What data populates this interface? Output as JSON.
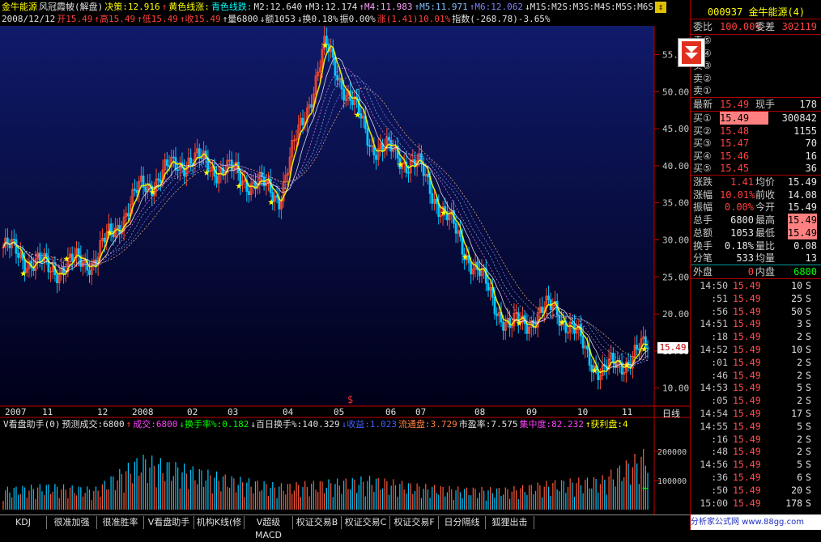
{
  "header": {
    "line1": [
      {
        "text": "金牛能源",
        "color": "#ffff00"
      },
      {
        "text": "风冠霞帔(解盘)",
        "color": "#e0e0e0"
      },
      {
        "text": "决策:12.916",
        "color": "#ffff00"
      },
      {
        "text": "↑",
        "color": "#ff4040"
      },
      {
        "text": "黄色线涨:",
        "color": "#ffff00"
      },
      {
        "text": "青色线跌:",
        "color": "#00ffff"
      },
      {
        "text": "M2:12.640",
        "color": "#e0e0e0"
      },
      {
        "text": "↑M3:12.174",
        "color": "#e0e0e0"
      },
      {
        "text": "↑M4:11.983",
        "color": "#ffa0ff"
      },
      {
        "text": "↑M5:11.971",
        "color": "#80c0ff"
      },
      {
        "text": "↑M6:12.062",
        "color": "#8080ff"
      },
      {
        "text": "↓M1S:M2S:M3S:M4S:M5S:M6S:",
        "color": "#e0e0e0"
      }
    ],
    "line2": [
      {
        "text": "2008/12/12",
        "color": "#e0e0e0"
      },
      {
        "text": "开15.49",
        "color": "#ff4040"
      },
      {
        "text": "↑高15.49",
        "color": "#ff4040"
      },
      {
        "text": "↑低15.49",
        "color": "#ff4040"
      },
      {
        "text": "↑收15.49",
        "color": "#ff4040"
      },
      {
        "text": "↑量6800",
        "color": "#e0e0e0"
      },
      {
        "text": "↓额1053",
        "color": "#e0e0e0"
      },
      {
        "text": "↓换0.18%",
        "color": "#e0e0e0"
      },
      {
        "text": "振0.00%",
        "color": "#e0e0e0"
      },
      {
        "text": "涨(1.41)10.01%",
        "color": "#ff4040"
      },
      {
        "text": "指数(-268.78)-3.65%",
        "color": "#e0e0e0"
      }
    ]
  },
  "indicator_header": [
    {
      "text": "V看盘助手(0)",
      "color": "#e0e0e0"
    },
    {
      "text": "预测成交:6800",
      "color": "#e0e0e0"
    },
    {
      "text": "↑",
      "color": "#ff4040"
    },
    {
      "text": "成交:6800",
      "color": "#ff40ff"
    },
    {
      "text": "↓换手率%:0.182",
      "color": "#00ff00"
    },
    {
      "text": "↓百日换手%:140.329",
      "color": "#e0e0e0"
    },
    {
      "text": "↓收益:1.023",
      "color": "#4060ff"
    },
    {
      "text": "流通盘:3.729",
      "color": "#ff8040"
    },
    {
      "text": "市盈率:7.575",
      "color": "#e0e0e0"
    },
    {
      "text": "集中度:82.232",
      "color": "#ff40ff"
    },
    {
      "text": "↑获利盘:4",
      "color": "#ffff00"
    }
  ],
  "day_line_label": "日线",
  "current_price_tag": "15.49",
  "y_axis_ticks": [
    "55.00",
    "50.00",
    "45.00",
    "40.00",
    "35.00",
    "30.00",
    "25.00",
    "20.00",
    "15.00",
    "10.00"
  ],
  "volume_axis_ticks": [
    "200000",
    "100000"
  ],
  "x_axis_labels": [
    "2007",
    "11",
    "12",
    "2008",
    "02",
    "03",
    "04",
    "05",
    "06",
    "07",
    "08",
    "09",
    "10",
    "11"
  ],
  "chart_data": {
    "type": "line",
    "title": "",
    "xlabel": "",
    "ylabel": "",
    "ylim": [
      8,
      58
    ],
    "x": [
      "2007-10",
      "2007-11",
      "2007-12",
      "2008-01",
      "2008-02",
      "2008-03",
      "2008-04",
      "2008-05",
      "2008-06",
      "2008-07",
      "2008-08",
      "2008-09",
      "2008-10",
      "2008-11",
      "2008-12"
    ],
    "series": [
      {
        "values": [
          29,
          26,
          27.5,
          37,
          41,
          39,
          36,
          56,
          43,
          40,
          29,
          18,
          21,
          12,
          15.49
        ]
      }
    ],
    "volume": {
      "ylim": [
        0,
        250000
      ],
      "values": [
        60000,
        70000,
        60000,
        150000,
        120000,
        90000,
        70000,
        80000,
        90000,
        70000,
        60000,
        60000,
        80000,
        90000,
        170000
      ]
    }
  },
  "right_panel": {
    "title": "000937 金牛能源(4)",
    "weibi": {
      "label": "委比",
      "value": "100.00%",
      "label2": "委差",
      "value2": "302119"
    },
    "sell": [
      {
        "label": "卖⑤",
        "price": "",
        "vol": ""
      },
      {
        "label": "卖④",
        "price": "",
        "vol": ""
      },
      {
        "label": "卖③",
        "price": "",
        "vol": ""
      },
      {
        "label": "卖②",
        "price": "",
        "vol": ""
      },
      {
        "label": "卖①",
        "price": "",
        "vol": ""
      }
    ],
    "latest": {
      "label": "最新",
      "price": "15.49",
      "label2": "现手",
      "value2": "178"
    },
    "buy": [
      {
        "label": "买①",
        "price": "15.49",
        "vol": "300842"
      },
      {
        "label": "买②",
        "price": "15.48",
        "vol": "1155"
      },
      {
        "label": "买③",
        "price": "15.47",
        "vol": "70"
      },
      {
        "label": "买④",
        "price": "15.46",
        "vol": "16"
      },
      {
        "label": "买⑤",
        "price": "15.45",
        "vol": "36"
      }
    ],
    "stats": [
      {
        "l1": "涨跌",
        "v1": "1.41",
        "l2": "均价",
        "v2": "15.49"
      },
      {
        "l1": "涨幅",
        "v1": "10.01%",
        "l2": "前收",
        "v2": "14.08"
      },
      {
        "l1": "振幅",
        "v1": "0.00%",
        "l2": "今开",
        "v2": "15.49"
      },
      {
        "l1": "总手",
        "v1": "6800",
        "l2": "最高",
        "v2": "15.49"
      },
      {
        "l1": "总额",
        "v1": "1053",
        "l2": "最低",
        "v2": "15.49"
      },
      {
        "l1": "换手",
        "v1": "0.18%",
        "l2": "量比",
        "v2": "0.08"
      },
      {
        "l1": "分笔",
        "v1": "533",
        "l2": "均量",
        "v2": "13"
      }
    ],
    "outer": {
      "l1": "外盘",
      "v1": "0",
      "l2": "内盘",
      "v2": "6800"
    },
    "ticks": [
      {
        "t": "14:50",
        "p": "15.49",
        "q": "10",
        "s": "S"
      },
      {
        "t": ":51",
        "p": "15.49",
        "q": "25",
        "s": "S"
      },
      {
        "t": ":56",
        "p": "15.49",
        "q": "50",
        "s": "S"
      },
      {
        "t": "14:51",
        "p": "15.49",
        "q": "3",
        "s": "S"
      },
      {
        "t": ":18",
        "p": "15.49",
        "q": "2",
        "s": "S"
      },
      {
        "t": "14:52",
        "p": "15.49",
        "q": "10",
        "s": "S"
      },
      {
        "t": ":01",
        "p": "15.49",
        "q": "2",
        "s": "S"
      },
      {
        "t": ":46",
        "p": "15.49",
        "q": "2",
        "s": "S"
      },
      {
        "t": "14:53",
        "p": "15.49",
        "q": "5",
        "s": "S"
      },
      {
        "t": ":05",
        "p": "15.49",
        "q": "2",
        "s": "S"
      },
      {
        "t": "14:54",
        "p": "15.49",
        "q": "17",
        "s": "S"
      },
      {
        "t": "14:55",
        "p": "15.49",
        "q": "5",
        "s": "S"
      },
      {
        "t": ":16",
        "p": "15.49",
        "q": "2",
        "s": "S"
      },
      {
        "t": ":48",
        "p": "15.49",
        "q": "2",
        "s": "S"
      },
      {
        "t": "14:56",
        "p": "15.49",
        "q": "5",
        "s": "S"
      },
      {
        "t": ":36",
        "p": "15.49",
        "q": "6",
        "s": "S"
      },
      {
        "t": ":50",
        "p": "15.49",
        "q": "20",
        "s": "S"
      },
      {
        "t": "15:00",
        "p": "15.49",
        "q": "178",
        "s": "S"
      }
    ],
    "watermark": "分析家公式网 www.88gg.com"
  },
  "bottom_tabs": [
    "KDJ",
    "很准加强",
    "很准胜率",
    "V看盘助手",
    "机构K线(修",
    "V超级MACD",
    "权证交易B",
    "权证交易C",
    "权证交易F",
    "日分隔线",
    "狐狸出击"
  ]
}
